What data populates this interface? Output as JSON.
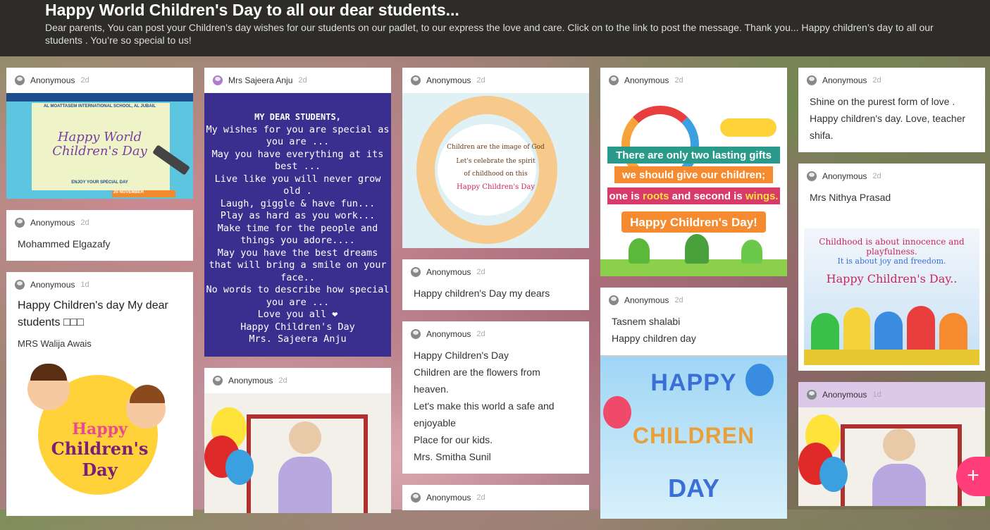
{
  "header": {
    "title": "Happy World Children's Day to all our dear students...",
    "description": "Dear parents, You can post your Children’s day wishes for our students on our padlet, to our express the love and care. Click on to the link to post the message. Thank you... Happy children’s day to all our students . You’re so special to us!"
  },
  "posts": {
    "c1p1": {
      "author": "Anonymous",
      "time": "2d",
      "image": {
        "school": "AL MOATTASEM INTERNATIONAL SCHOOL, AL JUBAIL",
        "line1": "Happy World",
        "line2": "Children's Day",
        "caption": "ENJOY YOUR SPECIAL DAY",
        "date": "20 NOVEMBER"
      }
    },
    "c1p2": {
      "author": "Anonymous",
      "time": "2d",
      "text": "Mohammed Elgazafy"
    },
    "c1p3": {
      "author": "Anonymous",
      "time": "1d",
      "title": "Happy Children's day My dear students □□□",
      "subtitle": "MRS Walija Awais",
      "image": {
        "line1": "Happy",
        "line2": "Children's",
        "line3": "Day"
      }
    },
    "c2p1": {
      "author": "Mrs Sajeera Anju",
      "time": "2d",
      "image": {
        "lines": [
          "MY DEAR STUDENTS,",
          "My wishes for you are special as you are ...",
          "May you have everything at its best ...",
          "Live like you will never grow old .",
          "Laugh, giggle & have fun...",
          "Play as hard as you work...",
          "Make time for the people and things you adore....",
          "May you have the best dreams that will bring a smile on your face..",
          "No words to describe how special you are ...",
          "Love you all ❤",
          "Happy Children's Day",
          "Mrs. Sajeera Anju"
        ]
      }
    },
    "c2p2": {
      "author": "Anonymous",
      "time": "2d"
    },
    "c3p1": {
      "author": "Anonymous",
      "time": "2d",
      "image": {
        "line1": "Children are the image of God",
        "line2": "Let's celebrate the spirit",
        "line3": "of childhood on this",
        "line4": "Happy Children's Day"
      }
    },
    "c3p2": {
      "author": "Anonymous",
      "time": "2d",
      "text": "Happy children's Day my dears"
    },
    "c3p3": {
      "author": "Anonymous",
      "time": "2d",
      "lines": [
        "Happy Children's Day",
        "Children are the flowers from heaven.",
        "Let's make this world a safe and enjoyable",
        "Place for our kids.",
        "Mrs. Smitha Sunil"
      ]
    },
    "c3p4": {
      "author": "Anonymous",
      "time": "2d"
    },
    "c4p1": {
      "author": "Anonymous",
      "time": "2d",
      "image": {
        "line1": "There are only two lasting gifts",
        "line2": "we should give our children;",
        "line3a": "one is ",
        "line3b": "roots",
        "line3c": " and second is ",
        "line3d": "wings.",
        "line4": "Happy Children's Day!"
      }
    },
    "c4p2": {
      "author": "Anonymous",
      "time": "2d",
      "lines": [
        "Tasnem shalabi",
        "Happy children day"
      ],
      "image": {
        "line1": "HAPPY",
        "line2": "CHILDREN",
        "line3": "DAY"
      }
    },
    "c5p1": {
      "author": "Anonymous",
      "time": "2d",
      "text": "Shine on the purest form of love . Happy children's day.  Love, teacher shifa."
    },
    "c5p2": {
      "author": "Anonymous",
      "time": "2d",
      "text": "Mrs Nithya Prasad",
      "image": {
        "line1": "Childhood is about innocence and playfulness.",
        "line2": "It is about joy and freedom.",
        "line3": "Happy Children's Day.."
      }
    },
    "c5p3": {
      "author": "Anonymous",
      "time": "1d"
    }
  },
  "fab": {
    "label": "+"
  },
  "colors": {
    "header_bg": "#2e2c29",
    "fab": "#ff3d7a",
    "purple_card": "#dcc8e8"
  }
}
